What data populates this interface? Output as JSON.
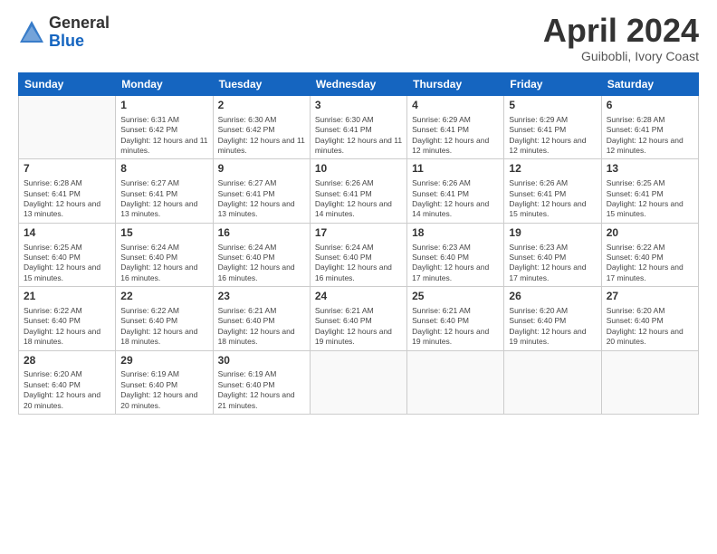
{
  "logo": {
    "general": "General",
    "blue": "Blue"
  },
  "header": {
    "month": "April 2024",
    "location": "Guibobli, Ivory Coast"
  },
  "weekdays": [
    "Sunday",
    "Monday",
    "Tuesday",
    "Wednesday",
    "Thursday",
    "Friday",
    "Saturday"
  ],
  "weeks": [
    [
      {
        "day": "",
        "sunrise": "",
        "sunset": "",
        "daylight": ""
      },
      {
        "day": "1",
        "sunrise": "Sunrise: 6:31 AM",
        "sunset": "Sunset: 6:42 PM",
        "daylight": "Daylight: 12 hours and 11 minutes."
      },
      {
        "day": "2",
        "sunrise": "Sunrise: 6:30 AM",
        "sunset": "Sunset: 6:42 PM",
        "daylight": "Daylight: 12 hours and 11 minutes."
      },
      {
        "day": "3",
        "sunrise": "Sunrise: 6:30 AM",
        "sunset": "Sunset: 6:41 PM",
        "daylight": "Daylight: 12 hours and 11 minutes."
      },
      {
        "day": "4",
        "sunrise": "Sunrise: 6:29 AM",
        "sunset": "Sunset: 6:41 PM",
        "daylight": "Daylight: 12 hours and 12 minutes."
      },
      {
        "day": "5",
        "sunrise": "Sunrise: 6:29 AM",
        "sunset": "Sunset: 6:41 PM",
        "daylight": "Daylight: 12 hours and 12 minutes."
      },
      {
        "day": "6",
        "sunrise": "Sunrise: 6:28 AM",
        "sunset": "Sunset: 6:41 PM",
        "daylight": "Daylight: 12 hours and 12 minutes."
      }
    ],
    [
      {
        "day": "7",
        "sunrise": "Sunrise: 6:28 AM",
        "sunset": "Sunset: 6:41 PM",
        "daylight": "Daylight: 12 hours and 13 minutes."
      },
      {
        "day": "8",
        "sunrise": "Sunrise: 6:27 AM",
        "sunset": "Sunset: 6:41 PM",
        "daylight": "Daylight: 12 hours and 13 minutes."
      },
      {
        "day": "9",
        "sunrise": "Sunrise: 6:27 AM",
        "sunset": "Sunset: 6:41 PM",
        "daylight": "Daylight: 12 hours and 13 minutes."
      },
      {
        "day": "10",
        "sunrise": "Sunrise: 6:26 AM",
        "sunset": "Sunset: 6:41 PM",
        "daylight": "Daylight: 12 hours and 14 minutes."
      },
      {
        "day": "11",
        "sunrise": "Sunrise: 6:26 AM",
        "sunset": "Sunset: 6:41 PM",
        "daylight": "Daylight: 12 hours and 14 minutes."
      },
      {
        "day": "12",
        "sunrise": "Sunrise: 6:26 AM",
        "sunset": "Sunset: 6:41 PM",
        "daylight": "Daylight: 12 hours and 15 minutes."
      },
      {
        "day": "13",
        "sunrise": "Sunrise: 6:25 AM",
        "sunset": "Sunset: 6:41 PM",
        "daylight": "Daylight: 12 hours and 15 minutes."
      }
    ],
    [
      {
        "day": "14",
        "sunrise": "Sunrise: 6:25 AM",
        "sunset": "Sunset: 6:40 PM",
        "daylight": "Daylight: 12 hours and 15 minutes."
      },
      {
        "day": "15",
        "sunrise": "Sunrise: 6:24 AM",
        "sunset": "Sunset: 6:40 PM",
        "daylight": "Daylight: 12 hours and 16 minutes."
      },
      {
        "day": "16",
        "sunrise": "Sunrise: 6:24 AM",
        "sunset": "Sunset: 6:40 PM",
        "daylight": "Daylight: 12 hours and 16 minutes."
      },
      {
        "day": "17",
        "sunrise": "Sunrise: 6:24 AM",
        "sunset": "Sunset: 6:40 PM",
        "daylight": "Daylight: 12 hours and 16 minutes."
      },
      {
        "day": "18",
        "sunrise": "Sunrise: 6:23 AM",
        "sunset": "Sunset: 6:40 PM",
        "daylight": "Daylight: 12 hours and 17 minutes."
      },
      {
        "day": "19",
        "sunrise": "Sunrise: 6:23 AM",
        "sunset": "Sunset: 6:40 PM",
        "daylight": "Daylight: 12 hours and 17 minutes."
      },
      {
        "day": "20",
        "sunrise": "Sunrise: 6:22 AM",
        "sunset": "Sunset: 6:40 PM",
        "daylight": "Daylight: 12 hours and 17 minutes."
      }
    ],
    [
      {
        "day": "21",
        "sunrise": "Sunrise: 6:22 AM",
        "sunset": "Sunset: 6:40 PM",
        "daylight": "Daylight: 12 hours and 18 minutes."
      },
      {
        "day": "22",
        "sunrise": "Sunrise: 6:22 AM",
        "sunset": "Sunset: 6:40 PM",
        "daylight": "Daylight: 12 hours and 18 minutes."
      },
      {
        "day": "23",
        "sunrise": "Sunrise: 6:21 AM",
        "sunset": "Sunset: 6:40 PM",
        "daylight": "Daylight: 12 hours and 18 minutes."
      },
      {
        "day": "24",
        "sunrise": "Sunrise: 6:21 AM",
        "sunset": "Sunset: 6:40 PM",
        "daylight": "Daylight: 12 hours and 19 minutes."
      },
      {
        "day": "25",
        "sunrise": "Sunrise: 6:21 AM",
        "sunset": "Sunset: 6:40 PM",
        "daylight": "Daylight: 12 hours and 19 minutes."
      },
      {
        "day": "26",
        "sunrise": "Sunrise: 6:20 AM",
        "sunset": "Sunset: 6:40 PM",
        "daylight": "Daylight: 12 hours and 19 minutes."
      },
      {
        "day": "27",
        "sunrise": "Sunrise: 6:20 AM",
        "sunset": "Sunset: 6:40 PM",
        "daylight": "Daylight: 12 hours and 20 minutes."
      }
    ],
    [
      {
        "day": "28",
        "sunrise": "Sunrise: 6:20 AM",
        "sunset": "Sunset: 6:40 PM",
        "daylight": "Daylight: 12 hours and 20 minutes."
      },
      {
        "day": "29",
        "sunrise": "Sunrise: 6:19 AM",
        "sunset": "Sunset: 6:40 PM",
        "daylight": "Daylight: 12 hours and 20 minutes."
      },
      {
        "day": "30",
        "sunrise": "Sunrise: 6:19 AM",
        "sunset": "Sunset: 6:40 PM",
        "daylight": "Daylight: 12 hours and 21 minutes."
      },
      {
        "day": "",
        "sunrise": "",
        "sunset": "",
        "daylight": ""
      },
      {
        "day": "",
        "sunrise": "",
        "sunset": "",
        "daylight": ""
      },
      {
        "day": "",
        "sunrise": "",
        "sunset": "",
        "daylight": ""
      },
      {
        "day": "",
        "sunrise": "",
        "sunset": "",
        "daylight": ""
      }
    ]
  ]
}
